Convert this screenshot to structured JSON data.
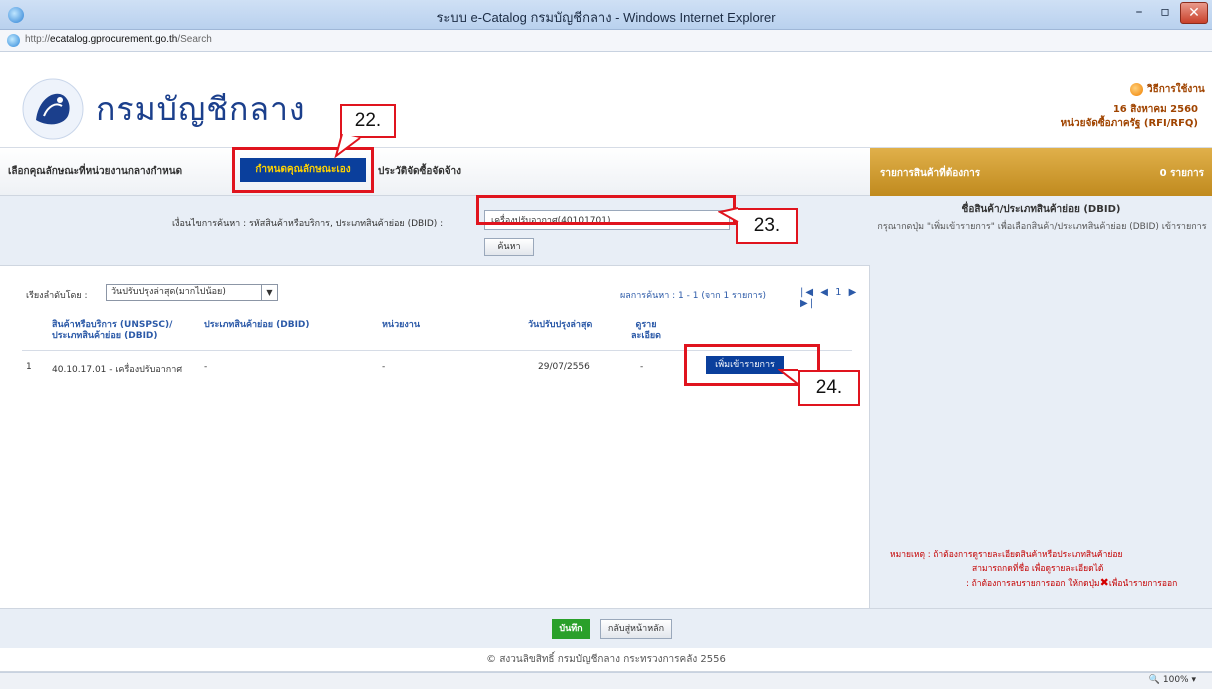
{
  "window": {
    "title": "ระบบ e-Catalog กรมบัญชีกลาง - Windows Internet Explorer",
    "min": "–",
    "max": "▫",
    "close": "✕"
  },
  "address": {
    "prefix": "http://",
    "host": "ecatalog.gprocurement.go.th",
    "path": "/Search"
  },
  "header": {
    "dept_name": "กรมบัญชีกลาง",
    "help": "วิธีการใช้งาน",
    "date": "16 สิงหาคม 2560",
    "unit": "หน่วยจัดซื้อภาครัฐ (RFI/RFQ)"
  },
  "tabs": [
    {
      "label": "เลือกคุณลักษณะที่หน่วยงานกลางกำหนด"
    },
    {
      "label": "กำหนดคุณลักษณะเอง"
    },
    {
      "label": "ประวัติจัดซื้อจัดจ้าง"
    }
  ],
  "cart": {
    "label": "รายการสินค้าที่ต้องการ",
    "count": "0 รายการ",
    "heading": "ชื่อสินค้า/ประเภทสินค้าย่อย (DBID)",
    "hint": "กรุณากดปุ่ม \"เพิ่มเข้ารายการ\" เพื่อเลือกสินค้า/ประเภทสินค้าย่อย (DBID) เข้ารายการ",
    "note1": "หมายเหตุ : ถ้าต้องการดูรายละเอียดสินค้าหรือประเภทสินค้าย่อย",
    "note2": "สามารถกดที่ชื่อ เพื่อดูรายละเอียดได้",
    "note3": ": ถ้าต้องการลบรายการออก ให้กดปุ่ม",
    "note3_end": "เพื่อนำรายการออก"
  },
  "search": {
    "label": "เงื่อนไขการค้นหา : รหัสสินค้าหรือบริการ, ประเภทสินค้าย่อย (DBID) :",
    "value": "เครื่องปรับอากาศ(40101701)",
    "button": "ค้นหา"
  },
  "results": {
    "sort_label": "เรียงลำดับโดย :",
    "sort_value": "วันปรับปรุงล่าสุด(มากไปน้อย)",
    "info": "ผลการค้นหา : 1 - 1 (จาก 1 รายการ)",
    "pager": "|◀ ◀ 1 ▶ ▶|",
    "columns": [
      "สินค้าหรือบริการ (UNSPSC)/ ประเภทสินค้าย่อย (DBID)",
      "ประเภทสินค้าย่อย (DBID)",
      "หน่วยงาน",
      "วันปรับปรุงล่าสุด",
      "ดูราย ละเอียด"
    ],
    "rows": [
      {
        "num": "1",
        "product": "40.10.17.01 - เครื่องปรับอากาศ",
        "dbid": "-",
        "unit": "-",
        "date": "29/07/2556",
        "detail": "-",
        "add": "เพิ่มเข้ารายการ"
      }
    ]
  },
  "footer": {
    "save": "บันทึก",
    "back": "กลับสู่หน้าหลัก",
    "copyright": "© สงวนลิขสิทธิ์ กรมบัญชีกลาง กระทรวงการคลัง 2556",
    "zoom": "🔍 100%  ▾"
  },
  "annotations": {
    "c22": "22.",
    "c23": "23.",
    "c24": "24."
  },
  "colors": {
    "annotation": "#e0141e",
    "tab_active_bg": "#0a3f9c",
    "tab_active_text": "#ffd200",
    "cart_bar": "#c08a1e"
  }
}
